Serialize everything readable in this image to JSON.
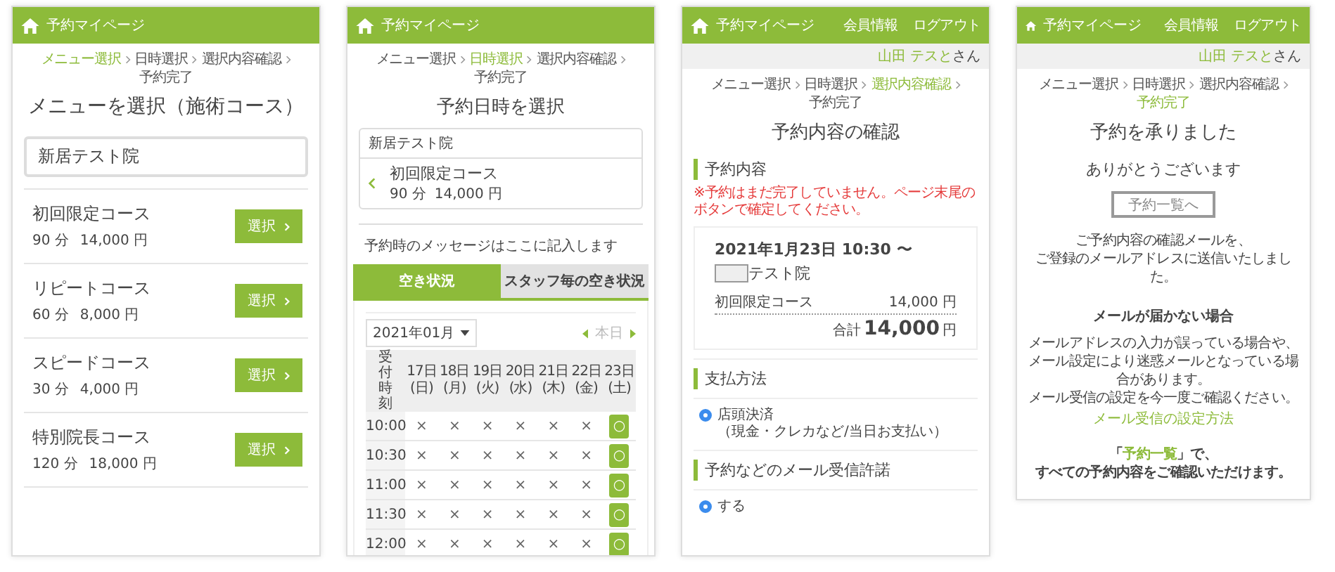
{
  "screens": [
    {
      "kind": "menu",
      "header": {
        "title": "予約マイページ"
      },
      "breadcrumb": [
        {
          "label": "メニュー選択",
          "selected": true
        },
        {
          "label": "日時選択",
          "selected": false
        },
        {
          "label": "選択内容確認",
          "selected": false
        },
        {
          "label": "予約完了",
          "selected": false
        }
      ],
      "title": "メニューを選択（施術コース）",
      "clinic": "新居テスト院",
      "courses": [
        {
          "name": "初回限定コース",
          "duration": "90 分",
          "price": "14,000 円",
          "button": "選択"
        },
        {
          "name": "リピートコース",
          "duration": "60 分",
          "price": "8,000 円",
          "button": "選択"
        },
        {
          "name": "スピードコース",
          "duration": "30 分",
          "price": "4,000 円",
          "button": "選択"
        },
        {
          "name": "特別院長コース",
          "duration": "120 分",
          "price": "18,000 円",
          "button": "選択"
        }
      ]
    },
    {
      "kind": "datetime",
      "header": {
        "title": "予約マイページ"
      },
      "breadcrumb": [
        {
          "label": "メニュー選択",
          "selected": false
        },
        {
          "label": "日時選択",
          "selected": true
        },
        {
          "label": "選択内容確認",
          "selected": false
        },
        {
          "label": "予約完了",
          "selected": false
        }
      ],
      "title": "予約日時を選択",
      "clinic": "新居テスト院",
      "course": {
        "name": "初回限定コース",
        "duration": "90 分",
        "price": "14,000 円"
      },
      "message": "予約時のメッセージはここに記入します",
      "tabs": [
        {
          "label": "空き状況",
          "selected": true
        },
        {
          "label": "スタッフ毎の空き状況",
          "selected": false
        }
      ],
      "calendar": {
        "month": "2021年01月",
        "today": {
          "label": "本日",
          "disabled": true
        },
        "corner": "受付時刻",
        "days": [
          {
            "date": "17日",
            "weekday": "(日)"
          },
          {
            "date": "18日",
            "weekday": "(月)"
          },
          {
            "date": "19日",
            "weekday": "(火)"
          },
          {
            "date": "20日",
            "weekday": "(水)"
          },
          {
            "date": "21日",
            "weekday": "(木)"
          },
          {
            "date": "22日",
            "weekday": "(金)"
          },
          {
            "date": "23日",
            "weekday": "(土)"
          }
        ],
        "rows": [
          {
            "time": "10:00",
            "slots": [
              {
                "mark": "×",
                "available": false
              },
              {
                "mark": "×",
                "available": false
              },
              {
                "mark": "×",
                "available": false
              },
              {
                "mark": "×",
                "available": false
              },
              {
                "mark": "×",
                "available": false
              },
              {
                "mark": "×",
                "available": false
              },
              {
                "mark": "○",
                "available": true
              }
            ]
          },
          {
            "time": "10:30",
            "slots": [
              {
                "mark": "×",
                "available": false
              },
              {
                "mark": "×",
                "available": false
              },
              {
                "mark": "×",
                "available": false
              },
              {
                "mark": "×",
                "available": false
              },
              {
                "mark": "×",
                "available": false
              },
              {
                "mark": "×",
                "available": false
              },
              {
                "mark": "○",
                "available": true
              }
            ]
          },
          {
            "time": "11:00",
            "slots": [
              {
                "mark": "×",
                "available": false
              },
              {
                "mark": "×",
                "available": false
              },
              {
                "mark": "×",
                "available": false
              },
              {
                "mark": "×",
                "available": false
              },
              {
                "mark": "×",
                "available": false
              },
              {
                "mark": "×",
                "available": false
              },
              {
                "mark": "○",
                "available": true
              }
            ]
          },
          {
            "time": "11:30",
            "slots": [
              {
                "mark": "×",
                "available": false
              },
              {
                "mark": "×",
                "available": false
              },
              {
                "mark": "×",
                "available": false
              },
              {
                "mark": "×",
                "available": false
              },
              {
                "mark": "×",
                "available": false
              },
              {
                "mark": "×",
                "available": false
              },
              {
                "mark": "○",
                "available": true
              }
            ]
          },
          {
            "time": "12:00",
            "slots": [
              {
                "mark": "×",
                "available": false
              },
              {
                "mark": "×",
                "available": false
              },
              {
                "mark": "×",
                "available": false
              },
              {
                "mark": "×",
                "available": false
              },
              {
                "mark": "×",
                "available": false
              },
              {
                "mark": "×",
                "available": false
              },
              {
                "mark": "○",
                "available": true
              }
            ]
          }
        ]
      }
    },
    {
      "kind": "confirm",
      "header": {
        "title": "予約マイページ",
        "nav": [
          "会員情報",
          "ログアウト"
        ]
      },
      "user": {
        "name": "山田 テスと",
        "suffix": "さん"
      },
      "breadcrumb": [
        {
          "label": "メニュー選択",
          "selected": false
        },
        {
          "label": "日時選択",
          "selected": false
        },
        {
          "label": "選択内容確認",
          "selected": true
        },
        {
          "label": "予約完了",
          "selected": false
        }
      ],
      "title": "予約内容の確認",
      "section": "予約内容",
      "warning": "※予約はまだ完了していません。ページ末尾のボタンで確定してください。",
      "booking": {
        "datetime": "2021年1月23日 10:30 〜",
        "clinic": "テスト院",
        "item": {
          "name": "初回限定コース",
          "price": "14,000 円"
        },
        "total": {
          "label": "合計",
          "amount": "14,000",
          "currency": "円"
        }
      },
      "options": [
        {
          "heading": "支払方法",
          "choice": {
            "label": "店頭決済",
            "note": "（現金・クレカなど/当日お支払い）",
            "selected": true
          }
        },
        {
          "heading": "予約などのメール受信許諾",
          "choice": {
            "label": "する",
            "selected": true
          }
        }
      ]
    },
    {
      "kind": "complete",
      "header": {
        "title": "予約マイページ",
        "nav": [
          "会員情報",
          "ログアウト"
        ]
      },
      "user": {
        "name": "山田 テスと",
        "suffix": "さん"
      },
      "breadcrumb": [
        {
          "label": "メニュー選択",
          "selected": false
        },
        {
          "label": "日時選択",
          "selected": false
        },
        {
          "label": "選択内容確認",
          "selected": false
        },
        {
          "label": "予約完了",
          "selected": true
        }
      ],
      "title": "予約を承りました",
      "thanks": "ありがとうございます",
      "button": "予約一覧へ",
      "sent": [
        "ご予約内容の確認メールを、",
        "ご登録のメールアドレスに送信いたしました。"
      ],
      "help_heading": "メールが届かない場合",
      "help": [
        "メールアドレスの入力が誤っている場合や、",
        "メール設定により迷惑メールとなっている場合があります。",
        "メール受信の設定を今一度ご確認ください。"
      ],
      "help_link": "メール受信の設定方法",
      "footer": {
        "before": "「",
        "link": "予約一覧",
        "after": "」で、",
        "line2": "すべての予約内容をご確認いただけます。"
      }
    }
  ]
}
